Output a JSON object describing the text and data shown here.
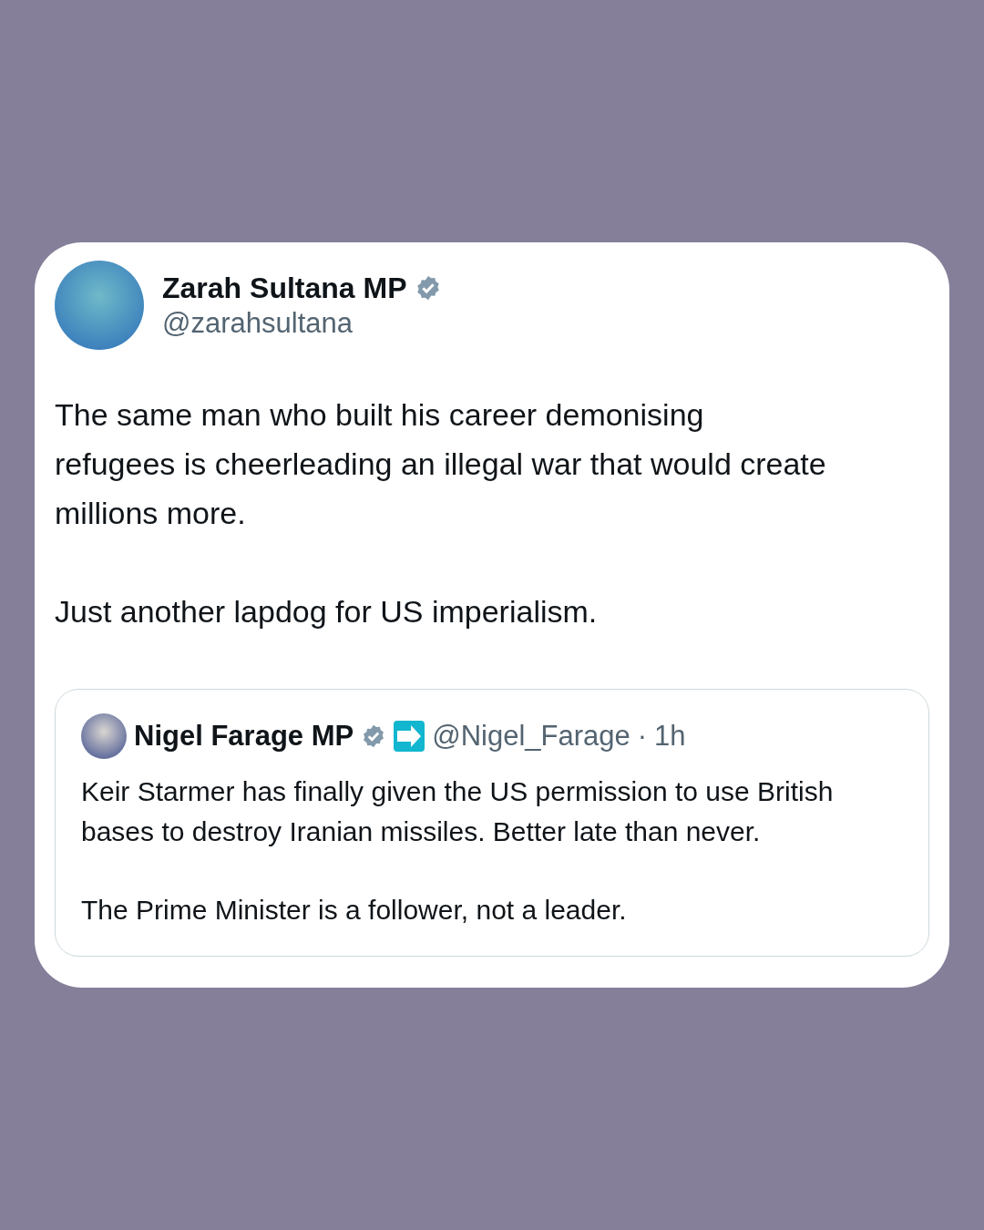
{
  "tweet": {
    "author": {
      "name": "Zarah Sultana MP",
      "handle": "@zarahsultana",
      "verified": true
    },
    "paragraphs": [
      "The same man who built his career demonising refugees is cheerleading an illegal war that would create millions more.",
      "Just another lapdog for US imperialism."
    ],
    "quote": {
      "author": {
        "name": "Nigel Farage MP",
        "handle": "@Nigel_Farage",
        "verified": true,
        "affiliate": true
      },
      "separator": "·",
      "time": "1h",
      "paragraphs": [
        "Keir Starmer has finally given the US permission to use British bases to destroy Iranian missiles. Better late than never.",
        "The Prime Minister is a follower, not a leader."
      ]
    }
  }
}
